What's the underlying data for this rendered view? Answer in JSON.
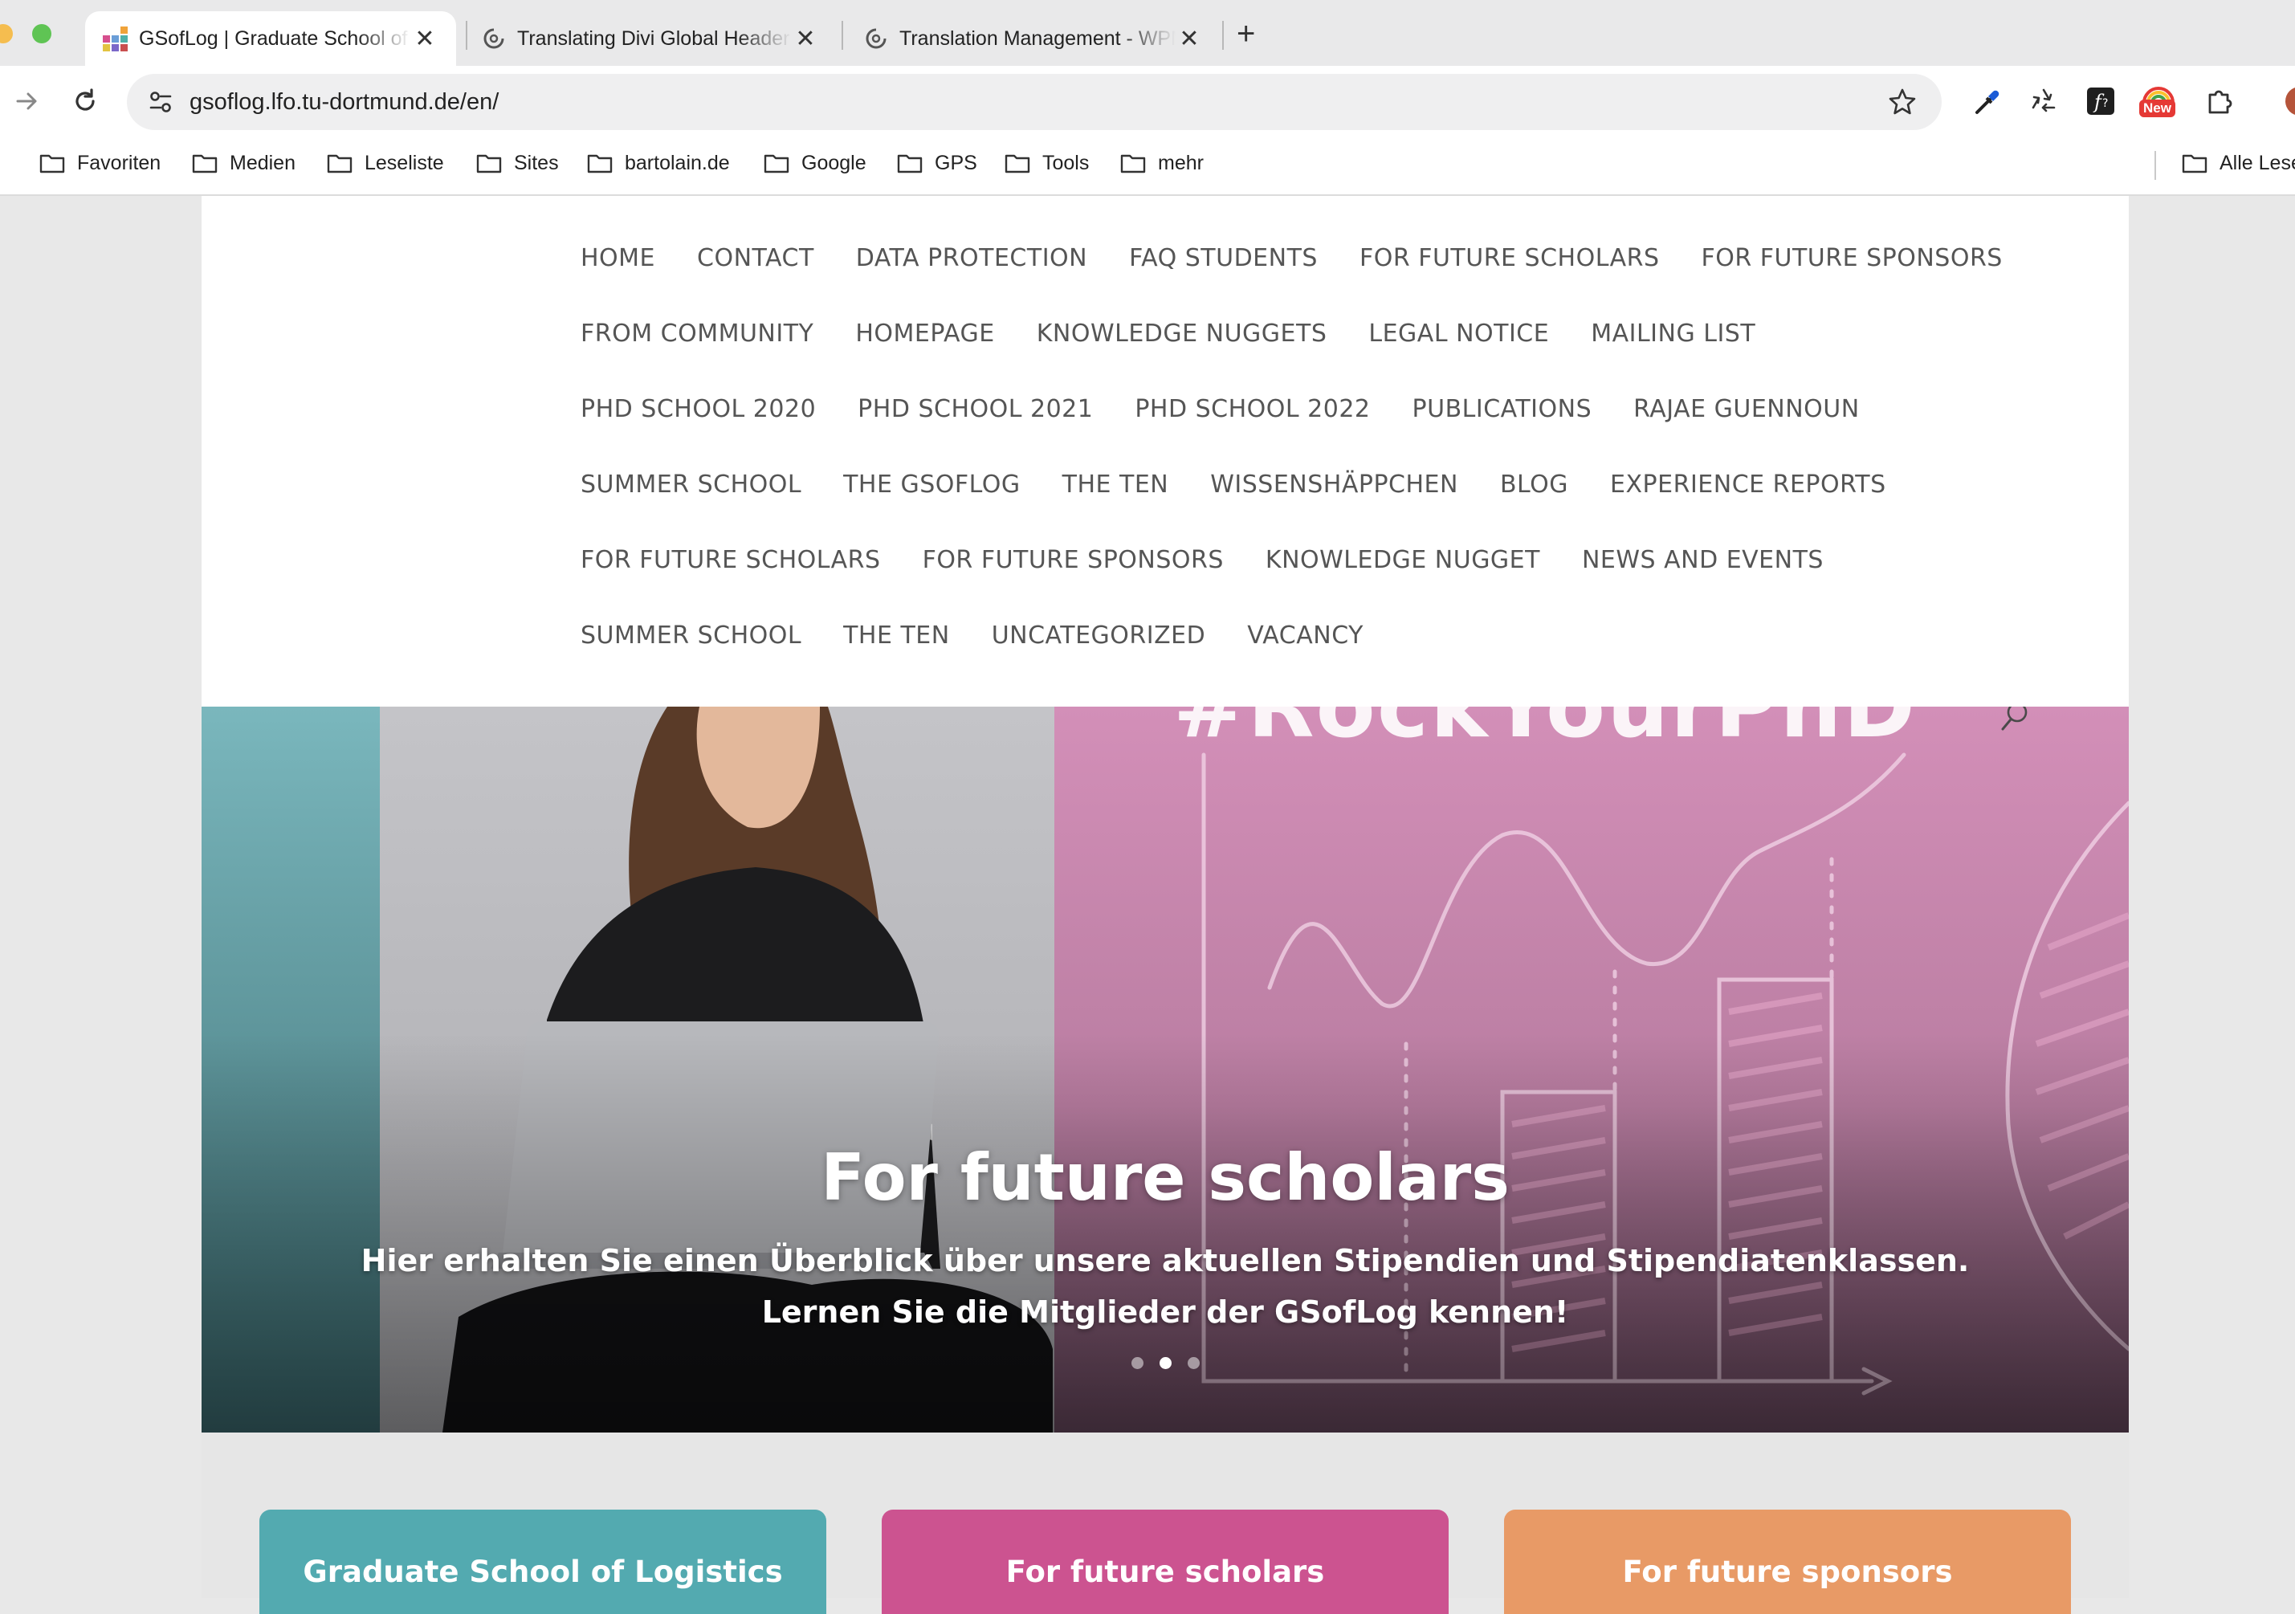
{
  "browser": {
    "tabs": [
      {
        "title": "GSofLog | Graduate School of Logistics",
        "active": true
      },
      {
        "title": "Translating Divi Global Header",
        "active": false
      },
      {
        "title": "Translation Management - WPML",
        "active": false
      }
    ],
    "url": "gsoflog.lfo.tu-dortmund.de/en/",
    "extension_badge": "New",
    "bookmarks": [
      "Favoriten",
      "Medien",
      "Leseliste",
      "Sites",
      "bartolain.de",
      "Google",
      "GPS",
      "Tools",
      "mehr"
    ],
    "all_bookmarks_label": "Alle Lesezeichen"
  },
  "menu": {
    "rows": [
      [
        "HOME",
        "CONTACT",
        "DATA PROTECTION",
        "FAQ STUDENTS",
        "FOR FUTURE SCHOLARS",
        "FOR FUTURE SPONSORS"
      ],
      [
        "FROM COMMUNITY",
        "HOMEPAGE",
        "KNOWLEDGE NUGGETS",
        "LEGAL NOTICE",
        "MAILING LIST"
      ],
      [
        "PHD SCHOOL 2020",
        "PHD SCHOOL 2021",
        "PHD SCHOOL 2022",
        "PUBLICATIONS",
        "RAJAE GUENNOUN"
      ],
      [
        "SUMMER SCHOOL",
        "THE GSOFLOG",
        "THE TEN",
        "WISSENSHÄPPCHEN",
        "BLOG",
        "EXPERIENCE REPORTS"
      ],
      [
        "FOR FUTURE SCHOLARS",
        "FOR FUTURE SPONSORS",
        "KNOWLEDGE NUGGET",
        "NEWS AND EVENTS"
      ],
      [
        "SUMMER SCHOOL",
        "THE TEN",
        "UNCATEGORIZED",
        "VACANCY"
      ]
    ]
  },
  "hero": {
    "hashtag": "#RockYourPhD",
    "title": "For future scholars",
    "text": "Hier erhalten Sie einen Überblick über unsere aktuellen Stipendien und Stipendiatenklassen. Lernen Sie die Mitglieder der GSofLog kennen!",
    "slides_total": 3,
    "active_slide": 2
  },
  "cards": [
    {
      "label": "Graduate School of Logistics",
      "color": "#53aab0"
    },
    {
      "label": "For future scholars",
      "color": "#cc5390"
    },
    {
      "label": "For future sponsors",
      "color": "#e89a66"
    }
  ]
}
